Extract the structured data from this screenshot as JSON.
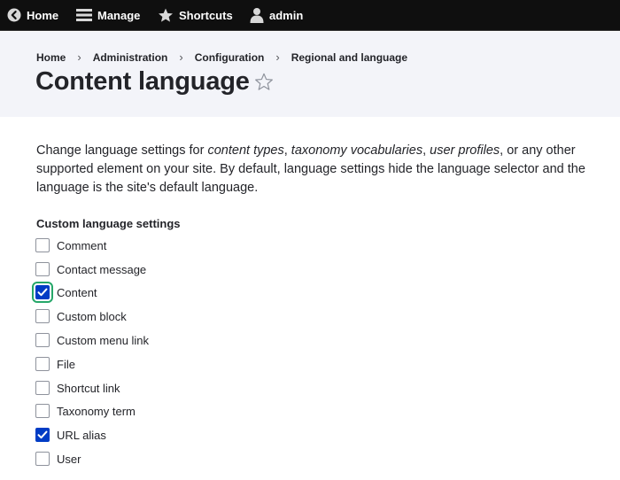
{
  "toolbar": {
    "home_label": "Home",
    "manage_label": "Manage",
    "shortcuts_label": "Shortcuts",
    "user_label": "admin"
  },
  "breadcrumb": [
    "Home",
    "Administration",
    "Configuration",
    "Regional and language"
  ],
  "breadcrumb_separator": "›",
  "page_title": "Content language",
  "description": {
    "part1": "Change language settings for ",
    "link1": "content types",
    "part2": ", ",
    "link2": "taxonomy vocabularies",
    "part3": ", ",
    "link3": "user profiles",
    "part4": ", or any other supported element on your site. By default, language settings hide the language selector and the language is the site's default language."
  },
  "custom_settings": {
    "legend": "Custom language settings",
    "items": [
      {
        "label": "Comment",
        "checked": false
      },
      {
        "label": "Contact message",
        "checked": false
      },
      {
        "label": "Content",
        "checked": true,
        "focused": true
      },
      {
        "label": "Custom block",
        "checked": false
      },
      {
        "label": "Custom menu link",
        "checked": false
      },
      {
        "label": "File",
        "checked": false
      },
      {
        "label": "Shortcut link",
        "checked": false
      },
      {
        "label": "Taxonomy term",
        "checked": false
      },
      {
        "label": "URL alias",
        "checked": true
      },
      {
        "label": "User",
        "checked": false
      }
    ]
  },
  "colors": {
    "toolbar_bg": "#0f0f0f",
    "header_bg": "#f3f4f9",
    "checkbox_checked": "#003cc5",
    "focus_ring": "#26a769"
  }
}
